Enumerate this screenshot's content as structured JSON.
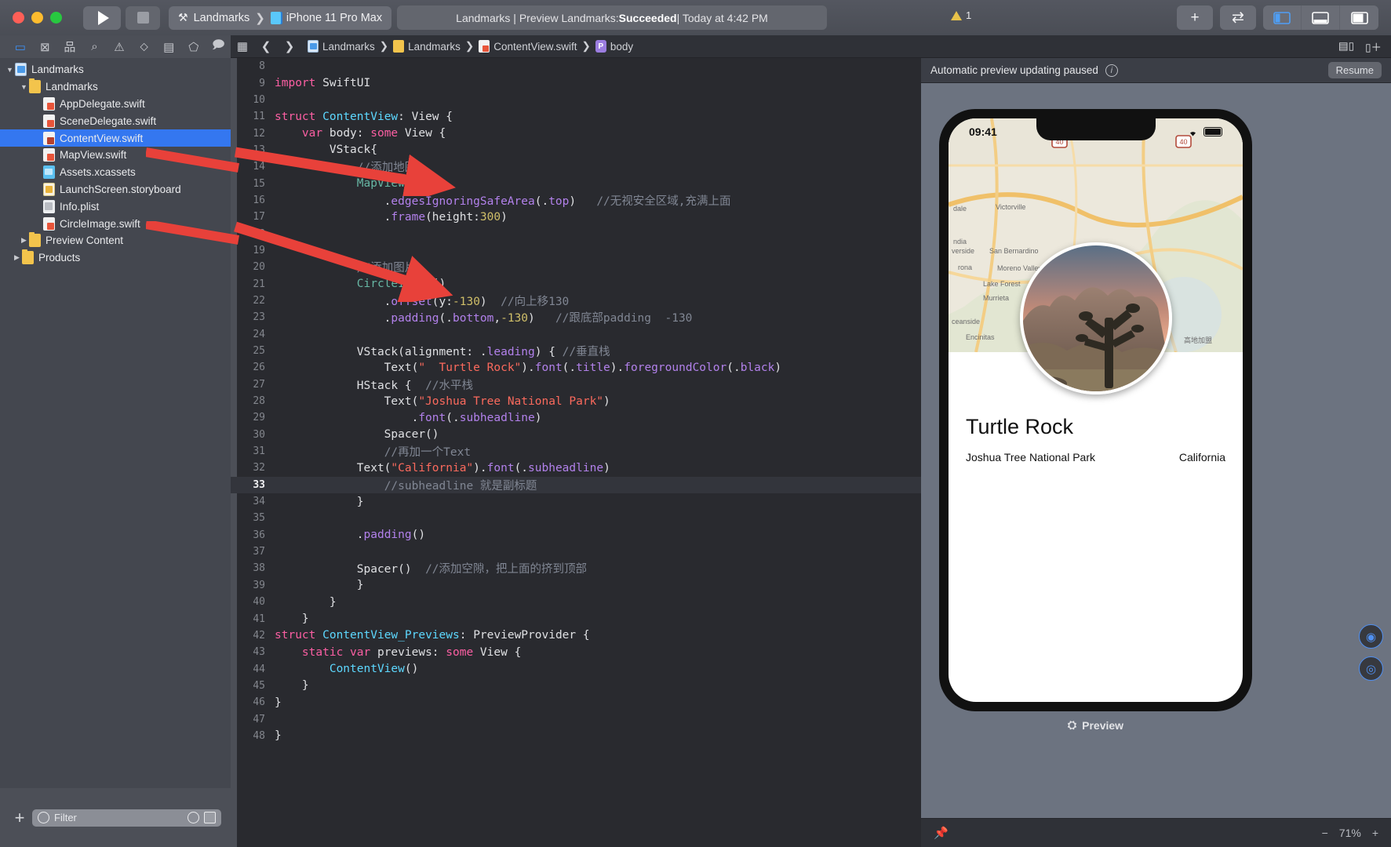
{
  "titlebar": {
    "run_label": "Run",
    "stop_label": "Stop",
    "scheme_project": "Landmarks",
    "scheme_separator": "❯",
    "scheme_device": "iPhone 11 Pro Max",
    "status_prefix": "Landmarks | Preview Landmarks: ",
    "status_bold": "Succeeded",
    "status_suffix": " | Today at 4:42 PM",
    "warning_count": "1",
    "add_label": "+",
    "toggle_label": "⇄",
    "panel_left_label": "Navigator",
    "panel_bottom_label": "Debug Area",
    "panel_right_label": "Inspector"
  },
  "nav_toolbar": {
    "items": [
      {
        "name": "project-navigator-icon",
        "glyph": "▭"
      },
      {
        "name": "source-control-navigator-icon",
        "glyph": "⊠"
      },
      {
        "name": "symbol-navigator-icon",
        "glyph": "品"
      },
      {
        "name": "find-navigator-icon",
        "glyph": "🔍"
      },
      {
        "name": "issue-navigator-icon",
        "glyph": "⚠"
      },
      {
        "name": "test-navigator-icon",
        "glyph": "◇"
      },
      {
        "name": "debug-navigator-icon",
        "glyph": "☰"
      },
      {
        "name": "breakpoint-navigator-icon",
        "glyph": "⌦"
      },
      {
        "name": "report-navigator-icon",
        "glyph": "💬"
      }
    ]
  },
  "navigator": {
    "items": [
      {
        "label": "Landmarks",
        "icon": "proj",
        "indent": 0,
        "disc": "▼",
        "selected": false
      },
      {
        "label": "Landmarks",
        "icon": "folder",
        "indent": 1,
        "disc": "▼",
        "selected": false
      },
      {
        "label": "AppDelegate.swift",
        "icon": "swift",
        "indent": 2,
        "disc": "",
        "selected": false
      },
      {
        "label": "SceneDelegate.swift",
        "icon": "swift",
        "indent": 2,
        "disc": "",
        "selected": false
      },
      {
        "label": "ContentView.swift",
        "icon": "swift",
        "indent": 2,
        "disc": "",
        "selected": true
      },
      {
        "label": "MapView.swift",
        "icon": "swift",
        "indent": 2,
        "disc": "",
        "selected": false
      },
      {
        "label": "Assets.xcassets",
        "icon": "assets",
        "indent": 2,
        "disc": "",
        "selected": false
      },
      {
        "label": "LaunchScreen.storyboard",
        "icon": "story",
        "indent": 2,
        "disc": "",
        "selected": false
      },
      {
        "label": "Info.plist",
        "icon": "plist",
        "indent": 2,
        "disc": "",
        "selected": false
      },
      {
        "label": "CircleImage.swift",
        "icon": "swift",
        "indent": 2,
        "disc": "",
        "selected": false
      },
      {
        "label": "Preview Content",
        "icon": "folder",
        "indent": 1,
        "disc": "▶",
        "selected": false
      },
      {
        "label": "Products",
        "icon": "folder",
        "indent": 0.5,
        "disc": "▶",
        "selected": false
      }
    ],
    "footer": {
      "add_label": "+",
      "filter_placeholder": "Filter",
      "recent_icon": "clock-icon",
      "sourcecontrol_icon": "source-control-icon"
    }
  },
  "jumpbar": {
    "grid_icon": "related-items-icon",
    "back_label": "❮",
    "forward_label": "❯",
    "crumbs": [
      {
        "label": "Landmarks",
        "icon": "proj"
      },
      {
        "label": "Landmarks",
        "icon": "folder"
      },
      {
        "label": "ContentView.swift",
        "icon": "swift"
      },
      {
        "label": "body",
        "icon": "body"
      }
    ],
    "right_icons": [
      {
        "name": "minimap-icon",
        "glyph": "▤"
      },
      {
        "name": "add-editor-icon",
        "glyph": "⊞"
      }
    ]
  },
  "editor": {
    "current_line": 33,
    "first_line": 8,
    "lines": [
      {
        "n": 8,
        "tokens": []
      },
      {
        "n": 9,
        "tokens": [
          {
            "t": "kw",
            "v": "import"
          },
          {
            "t": "plain",
            "v": " SwiftUI"
          }
        ]
      },
      {
        "n": 10,
        "tokens": []
      },
      {
        "n": 11,
        "tokens": [
          {
            "t": "kw",
            "v": "struct"
          },
          {
            "t": "plain",
            "v": " "
          },
          {
            "t": "typ",
            "v": "ContentView"
          },
          {
            "t": "plain",
            "v": ": View {"
          }
        ]
      },
      {
        "n": 12,
        "tokens": [
          {
            "t": "plain",
            "v": "    "
          },
          {
            "t": "kw",
            "v": "var"
          },
          {
            "t": "plain",
            "v": " body: "
          },
          {
            "t": "kw",
            "v": "some"
          },
          {
            "t": "plain",
            "v": " View {"
          }
        ]
      },
      {
        "n": 13,
        "tokens": [
          {
            "t": "plain",
            "v": "        VStack{"
          }
        ]
      },
      {
        "n": 14,
        "tokens": [
          {
            "t": "plain",
            "v": "            "
          },
          {
            "t": "cmt",
            "v": "//添加地图"
          }
        ]
      },
      {
        "n": 15,
        "tokens": [
          {
            "t": "plain",
            "v": "            "
          },
          {
            "t": "fn",
            "v": "MapView"
          },
          {
            "t": "plain",
            "v": "()"
          }
        ]
      },
      {
        "n": 16,
        "tokens": [
          {
            "t": "plain",
            "v": "                ."
          },
          {
            "t": "meth",
            "v": "edgesIgnoringSafeArea"
          },
          {
            "t": "plain",
            "v": "(."
          },
          {
            "t": "meth",
            "v": "top"
          },
          {
            "t": "plain",
            "v": ")   "
          },
          {
            "t": "cmt",
            "v": "//无视安全区域,充满上面"
          }
        ]
      },
      {
        "n": 17,
        "tokens": [
          {
            "t": "plain",
            "v": "                ."
          },
          {
            "t": "meth",
            "v": "frame"
          },
          {
            "t": "plain",
            "v": "(height:"
          },
          {
            "t": "num2",
            "v": "300"
          },
          {
            "t": "plain",
            "v": ")"
          }
        ]
      },
      {
        "n": 18,
        "tokens": []
      },
      {
        "n": 19,
        "tokens": []
      },
      {
        "n": 20,
        "tokens": [
          {
            "t": "plain",
            "v": "            "
          },
          {
            "t": "cmt",
            "v": "//添加图片"
          }
        ]
      },
      {
        "n": 21,
        "tokens": [
          {
            "t": "plain",
            "v": "            "
          },
          {
            "t": "fn",
            "v": "CircleImage"
          },
          {
            "t": "plain",
            "v": "()"
          }
        ]
      },
      {
        "n": 22,
        "tokens": [
          {
            "t": "plain",
            "v": "                ."
          },
          {
            "t": "meth",
            "v": "offset"
          },
          {
            "t": "plain",
            "v": "(y:"
          },
          {
            "t": "num2",
            "v": "-130"
          },
          {
            "t": "plain",
            "v": ")  "
          },
          {
            "t": "cmt",
            "v": "//向上移130"
          }
        ]
      },
      {
        "n": 23,
        "tokens": [
          {
            "t": "plain",
            "v": "                ."
          },
          {
            "t": "meth",
            "v": "padding"
          },
          {
            "t": "plain",
            "v": "(."
          },
          {
            "t": "meth",
            "v": "bottom"
          },
          {
            "t": "plain",
            "v": ","
          },
          {
            "t": "num2",
            "v": "-130"
          },
          {
            "t": "plain",
            "v": ")   "
          },
          {
            "t": "cmt",
            "v": "//跟底部padding  -130"
          }
        ]
      },
      {
        "n": 24,
        "tokens": []
      },
      {
        "n": 25,
        "tokens": [
          {
            "t": "plain",
            "v": "            VStack(alignment: ."
          },
          {
            "t": "meth",
            "v": "leading"
          },
          {
            "t": "plain",
            "v": ") { "
          },
          {
            "t": "cmt",
            "v": "//垂直栈"
          }
        ]
      },
      {
        "n": 26,
        "tokens": [
          {
            "t": "plain",
            "v": "                Text("
          },
          {
            "t": "str",
            "v": "\"  Turtle Rock\""
          },
          {
            "t": "plain",
            "v": ")."
          },
          {
            "t": "meth",
            "v": "font"
          },
          {
            "t": "plain",
            "v": "(."
          },
          {
            "t": "meth",
            "v": "title"
          },
          {
            "t": "plain",
            "v": ")."
          },
          {
            "t": "meth",
            "v": "foregroundColor"
          },
          {
            "t": "plain",
            "v": "(."
          },
          {
            "t": "meth",
            "v": "black"
          },
          {
            "t": "plain",
            "v": ")"
          }
        ]
      },
      {
        "n": 27,
        "tokens": [
          {
            "t": "plain",
            "v": "            HStack {  "
          },
          {
            "t": "cmt",
            "v": "//水平栈"
          }
        ]
      },
      {
        "n": 28,
        "tokens": [
          {
            "t": "plain",
            "v": "                Text("
          },
          {
            "t": "str",
            "v": "\"Joshua Tree National Park\""
          },
          {
            "t": "plain",
            "v": ")"
          }
        ]
      },
      {
        "n": 29,
        "tokens": [
          {
            "t": "plain",
            "v": "                    ."
          },
          {
            "t": "meth",
            "v": "font"
          },
          {
            "t": "plain",
            "v": "(."
          },
          {
            "t": "meth",
            "v": "subheadline"
          },
          {
            "t": "plain",
            "v": ")"
          }
        ]
      },
      {
        "n": 30,
        "tokens": [
          {
            "t": "plain",
            "v": "                Spacer()"
          }
        ]
      },
      {
        "n": 31,
        "tokens": [
          {
            "t": "plain",
            "v": "                "
          },
          {
            "t": "cmt",
            "v": "//再加一个Text"
          }
        ]
      },
      {
        "n": 32,
        "tokens": [
          {
            "t": "plain",
            "v": "            Text("
          },
          {
            "t": "str",
            "v": "\"California\""
          },
          {
            "t": "plain",
            "v": ")."
          },
          {
            "t": "meth",
            "v": "font"
          },
          {
            "t": "plain",
            "v": "(."
          },
          {
            "t": "meth",
            "v": "subheadline"
          },
          {
            "t": "plain",
            "v": ")"
          }
        ]
      },
      {
        "n": 33,
        "tokens": [
          {
            "t": "plain",
            "v": "                "
          },
          {
            "t": "cmt",
            "v": "//subheadline 就是副标题"
          }
        ]
      },
      {
        "n": 34,
        "tokens": [
          {
            "t": "plain",
            "v": "            }"
          }
        ]
      },
      {
        "n": 35,
        "tokens": []
      },
      {
        "n": 36,
        "tokens": [
          {
            "t": "plain",
            "v": "            ."
          },
          {
            "t": "meth",
            "v": "padding"
          },
          {
            "t": "plain",
            "v": "()"
          }
        ]
      },
      {
        "n": 37,
        "tokens": []
      },
      {
        "n": 38,
        "tokens": [
          {
            "t": "plain",
            "v": "            Spacer()  "
          },
          {
            "t": "cmt",
            "v": "//添加空隙，把上面的挤到顶部"
          }
        ]
      },
      {
        "n": 39,
        "tokens": [
          {
            "t": "plain",
            "v": "            }"
          }
        ]
      },
      {
        "n": 40,
        "tokens": [
          {
            "t": "plain",
            "v": "        }"
          }
        ]
      },
      {
        "n": 41,
        "tokens": [
          {
            "t": "plain",
            "v": "    }"
          }
        ]
      },
      {
        "n": 42,
        "tokens": [
          {
            "t": "kw",
            "v": "struct"
          },
          {
            "t": "plain",
            "v": " "
          },
          {
            "t": "typ",
            "v": "ContentView_Previews"
          },
          {
            "t": "plain",
            "v": ": PreviewProvider {"
          }
        ]
      },
      {
        "n": 43,
        "tokens": [
          {
            "t": "plain",
            "v": "    "
          },
          {
            "t": "kw",
            "v": "static var"
          },
          {
            "t": "plain",
            "v": " previews: "
          },
          {
            "t": "kw",
            "v": "some"
          },
          {
            "t": "plain",
            "v": " View {"
          }
        ]
      },
      {
        "n": 44,
        "tokens": [
          {
            "t": "plain",
            "v": "        "
          },
          {
            "t": "typ",
            "v": "ContentView"
          },
          {
            "t": "plain",
            "v": "()"
          }
        ]
      },
      {
        "n": 45,
        "tokens": [
          {
            "t": "plain",
            "v": "    }"
          }
        ]
      },
      {
        "n": 46,
        "tokens": [
          {
            "t": "plain",
            "v": "}"
          }
        ]
      },
      {
        "n": 47,
        "tokens": []
      },
      {
        "n": 48,
        "tokens": [
          {
            "t": "plain",
            "v": "}"
          }
        ]
      }
    ]
  },
  "preview": {
    "header_text": "Automatic preview updating paused",
    "info_glyph": "i",
    "resume_label": "Resume",
    "device_time": "09:41",
    "app": {
      "title": "Turtle Rock",
      "park": "Joshua Tree National Park",
      "state": "California"
    },
    "preview_label": "Preview",
    "zoom_level": "71%",
    "zoom_out": "−",
    "zoom_in": "+",
    "pin_icon": "pin-icon"
  },
  "colors": {
    "accent": "#3477f0",
    "keyword": "#fc5fa3",
    "type": "#5dd8ff",
    "function": "#67b7a4",
    "method": "#b281eb",
    "string": "#fc6a5d",
    "number": "#d0bf69",
    "comment": "#808693",
    "arrow": "#e8413a"
  }
}
